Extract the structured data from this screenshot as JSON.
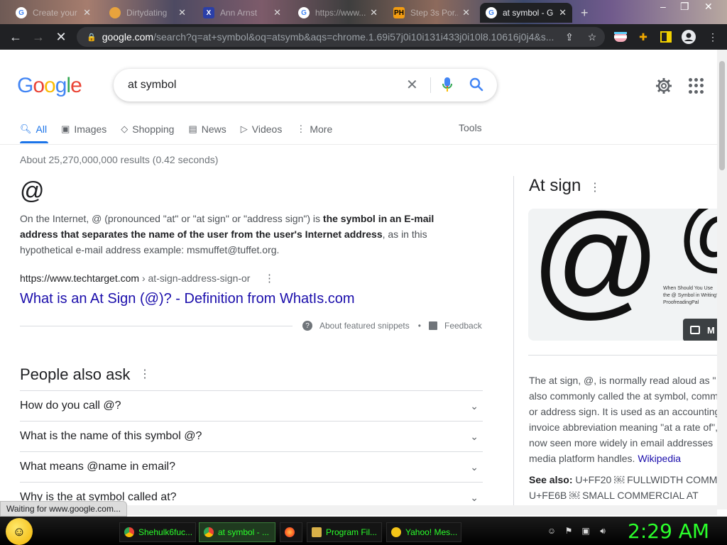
{
  "browser": {
    "tabs": [
      {
        "title": "Create your ...",
        "favicon": "chrome-icon"
      },
      {
        "title": "Dirtydating",
        "favicon": "heart-icon"
      },
      {
        "title": "Ann Arnst",
        "favicon": "x-icon"
      },
      {
        "title": "https://www...",
        "favicon": "google-icon"
      },
      {
        "title": "Step 3s Por...",
        "favicon": "ph-icon"
      },
      {
        "title": "at symbol - G",
        "favicon": "google-icon"
      }
    ],
    "new_tab": "+",
    "url_host": "google.com",
    "url_path": "/search?q=at+symbol&oq=atsymb&aqs=chrome.1.69i57j0i10i131i433j0i10l8.10616j0j4&s..."
  },
  "search": {
    "logo": "Google",
    "query": "at symbol"
  },
  "navtabs": {
    "items": [
      "All",
      "Images",
      "Shopping",
      "News",
      "Videos",
      "More"
    ],
    "tools": "Tools"
  },
  "results": {
    "stats": "About 25,270,000,000 results (0.42 seconds)",
    "glyph": "@",
    "snippet_a": "On the Internet, @ (pronounced \"at\" or \"at sign\" or \"address sign\") is ",
    "snippet_b": "the symbol in an E-mail address that separates the name of the user from the user's Internet address",
    "snippet_c": ", as in this hypothetical e-mail address example: msmuffet@tuffet.org.",
    "source_host": "https://www.techtarget.com",
    "source_crumb": " › at-sign-address-sign-or",
    "link_title": "What is an At Sign (@)? - Definition from WhatIs.com",
    "about_snippets": "About featured snippets",
    "bullet": "•",
    "feedback": "Feedback"
  },
  "paa": {
    "title": "People also ask",
    "questions": [
      "How do you call @?",
      "What is the name of this symbol @?",
      "What means @name in email?",
      "Why is the at symbol called at?"
    ]
  },
  "knowledge_panel": {
    "title": "At sign",
    "image_glyph": "@",
    "image_caption": "When Should You Use the @ Symbol in Writing?",
    "image_caption_src": "ProofreadingPal",
    "more_images": "M",
    "desc_lines": [
      "The at sign, @, is normally read aloud as \"",
      "also commonly called the at symbol, comm",
      "or address sign. It is used as an accounting",
      "invoice abbreviation meaning \"at a rate of\",",
      "now seen more widely in email addresses",
      "media platform handles. "
    ],
    "wiki_link": "Wikipedia",
    "see_also_label": "See also:",
    "see_also_1": " U+FF20 ￼ FULLWIDTH COMME",
    "see_also_2": "U+FE6B ￼ SMALL COMMERCIAL AT"
  },
  "status": {
    "text": "Waiting for www.google.com..."
  },
  "taskbar": {
    "items": [
      {
        "label": "Shehulk6fuc...",
        "icon": "chrome-icon"
      },
      {
        "label": "at symbol - ...",
        "icon": "chrome-icon"
      },
      {
        "label": "",
        "icon": "firefox-icon"
      },
      {
        "label": "Program Fil...",
        "icon": "folder-icon"
      },
      {
        "label": "Yahoo! Mes...",
        "icon": "yahoo-messenger-icon"
      }
    ],
    "clock": "2:29 AM"
  }
}
